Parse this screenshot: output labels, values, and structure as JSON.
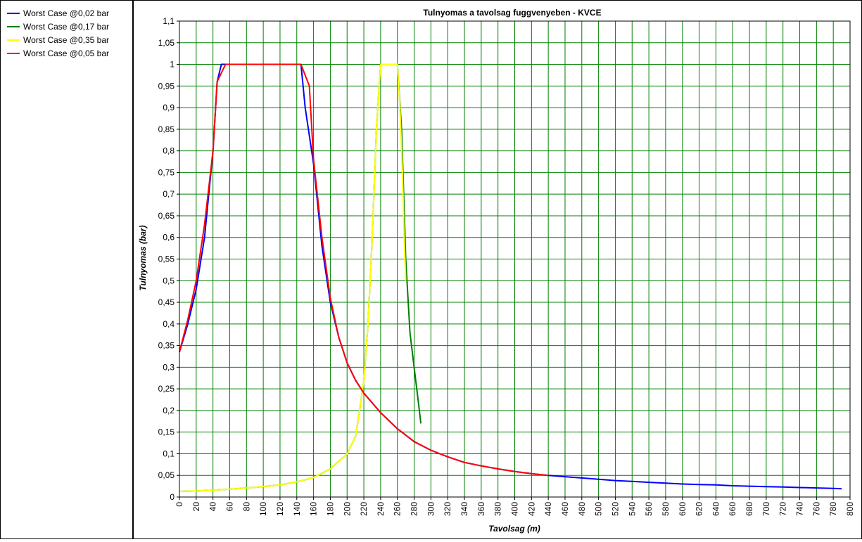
{
  "chart_data": {
    "type": "line",
    "title": "Tulnyomas a tavolsag fuggvenyeben - KVCE",
    "xlabel": "Tavolsag (m)",
    "ylabel": "Tulnyomas (bar)",
    "xlim": [
      0,
      800
    ],
    "ylim": [
      0,
      1.1
    ],
    "x_ticks": [
      "0",
      "20",
      "40",
      "60",
      "80",
      "100",
      "120",
      "140",
      "160",
      "180",
      "200",
      "220",
      "240",
      "260",
      "280",
      "300",
      "320",
      "340",
      "360",
      "380",
      "400",
      "420",
      "440",
      "460",
      "480",
      "500",
      "520",
      "540",
      "560",
      "580",
      "600",
      "620",
      "640",
      "660",
      "680",
      "700",
      "720",
      "740",
      "760",
      "780",
      "800"
    ],
    "y_ticks": [
      "0",
      "0,05",
      "0,1",
      "0,15",
      "0,2",
      "0,25",
      "0,3",
      "0,35",
      "0,4",
      "0,45",
      "0,5",
      "0,55",
      "0,6",
      "0,65",
      "0,7",
      "0,75",
      "0,8",
      "0,85",
      "0,9",
      "0,95",
      "1",
      "1,05",
      "1,1"
    ],
    "grid": true,
    "grid_color": "#008000",
    "legend_position": "left-panel",
    "series": [
      {
        "name": "Worst Case @0,02 bar",
        "color": "#0000ff",
        "points": [
          [
            0,
            0.335
          ],
          [
            10,
            0.4
          ],
          [
            20,
            0.48
          ],
          [
            30,
            0.6
          ],
          [
            40,
            0.8
          ],
          [
            45,
            0.96
          ],
          [
            50,
            1.0
          ],
          [
            60,
            1.0
          ],
          [
            80,
            1.0
          ],
          [
            100,
            1.0
          ],
          [
            120,
            1.0
          ],
          [
            140,
            1.0
          ],
          [
            145,
            1.0
          ],
          [
            150,
            0.9
          ],
          [
            160,
            0.77
          ],
          [
            170,
            0.58
          ],
          [
            180,
            0.45
          ],
          [
            190,
            0.37
          ],
          [
            200,
            0.31
          ],
          [
            210,
            0.27
          ],
          [
            220,
            0.24
          ],
          [
            240,
            0.195
          ],
          [
            260,
            0.158
          ],
          [
            280,
            0.128
          ],
          [
            300,
            0.108
          ],
          [
            320,
            0.093
          ],
          [
            340,
            0.08
          ],
          [
            360,
            0.072
          ],
          [
            380,
            0.065
          ],
          [
            400,
            0.059
          ],
          [
            420,
            0.054
          ],
          [
            440,
            0.05
          ],
          [
            460,
            0.047
          ],
          [
            480,
            0.044
          ],
          [
            500,
            0.041
          ],
          [
            520,
            0.038
          ],
          [
            540,
            0.036
          ],
          [
            560,
            0.034
          ],
          [
            580,
            0.032
          ],
          [
            600,
            0.03
          ],
          [
            620,
            0.029
          ],
          [
            640,
            0.028
          ],
          [
            660,
            0.026
          ],
          [
            680,
            0.025
          ],
          [
            700,
            0.024
          ],
          [
            720,
            0.023
          ],
          [
            740,
            0.022
          ],
          [
            760,
            0.021
          ],
          [
            780,
            0.02
          ],
          [
            790,
            0.019
          ]
        ]
      },
      {
        "name": "Worst Case @0,17 bar",
        "color": "#008000",
        "points": [
          [
            0,
            0.013
          ],
          [
            20,
            0.014
          ],
          [
            40,
            0.016
          ],
          [
            60,
            0.018
          ],
          [
            80,
            0.021
          ],
          [
            100,
            0.024
          ],
          [
            120,
            0.028
          ],
          [
            140,
            0.035
          ],
          [
            160,
            0.045
          ],
          [
            180,
            0.065
          ],
          [
            200,
            0.1
          ],
          [
            210,
            0.14
          ],
          [
            215,
            0.2
          ],
          [
            220,
            0.27
          ],
          [
            225,
            0.4
          ],
          [
            230,
            0.6
          ],
          [
            235,
            0.85
          ],
          [
            240,
            1.0
          ],
          [
            250,
            1.0
          ],
          [
            260,
            1.0
          ],
          [
            265,
            0.85
          ],
          [
            270,
            0.55
          ],
          [
            275,
            0.38
          ],
          [
            280,
            0.3
          ],
          [
            285,
            0.22
          ],
          [
            288,
            0.17
          ]
        ]
      },
      {
        "name": "Worst Case @0,35 bar",
        "color": "#ffff00",
        "points": [
          [
            0,
            0.013
          ],
          [
            20,
            0.014
          ],
          [
            40,
            0.016
          ],
          [
            60,
            0.018
          ],
          [
            80,
            0.021
          ],
          [
            100,
            0.024
          ],
          [
            120,
            0.028
          ],
          [
            140,
            0.035
          ],
          [
            160,
            0.045
          ],
          [
            180,
            0.065
          ],
          [
            200,
            0.1
          ],
          [
            210,
            0.14
          ],
          [
            215,
            0.2
          ],
          [
            220,
            0.27
          ],
          [
            225,
            0.4
          ],
          [
            230,
            0.6
          ],
          [
            235,
            0.85
          ],
          [
            240,
            1.0
          ],
          [
            250,
            1.0
          ],
          [
            260,
            1.0
          ],
          [
            263,
            0.9
          ],
          [
            266,
            0.75
          ],
          [
            268,
            0.6
          ],
          [
            270,
            0.5
          ]
        ]
      },
      {
        "name": "Worst Case @0,05 bar",
        "color": "#ff0000",
        "points": [
          [
            0,
            0.335
          ],
          [
            10,
            0.41
          ],
          [
            20,
            0.5
          ],
          [
            30,
            0.63
          ],
          [
            40,
            0.8
          ],
          [
            45,
            0.96
          ],
          [
            55,
            1.0
          ],
          [
            80,
            1.0
          ],
          [
            100,
            1.0
          ],
          [
            120,
            1.0
          ],
          [
            140,
            1.0
          ],
          [
            145,
            1.0
          ],
          [
            155,
            0.95
          ],
          [
            160,
            0.78
          ],
          [
            170,
            0.6
          ],
          [
            180,
            0.46
          ],
          [
            190,
            0.37
          ],
          [
            200,
            0.31
          ],
          [
            210,
            0.27
          ],
          [
            220,
            0.24
          ],
          [
            240,
            0.195
          ],
          [
            260,
            0.158
          ],
          [
            280,
            0.128
          ],
          [
            300,
            0.108
          ],
          [
            320,
            0.093
          ],
          [
            340,
            0.08
          ],
          [
            360,
            0.072
          ],
          [
            380,
            0.065
          ],
          [
            400,
            0.059
          ],
          [
            420,
            0.054
          ],
          [
            440,
            0.05
          ]
        ]
      }
    ]
  }
}
